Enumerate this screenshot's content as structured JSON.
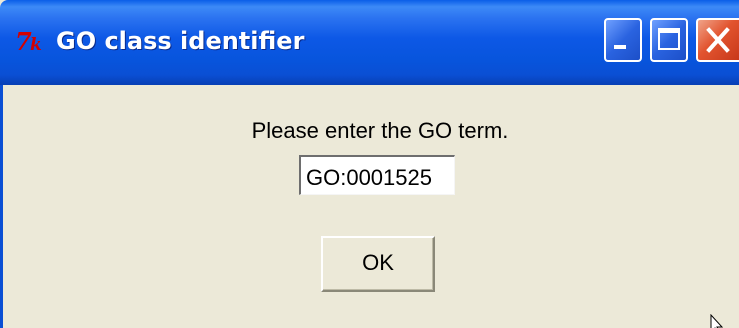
{
  "window": {
    "title": "GO class identifier",
    "title_icon": "tk-feather-icon",
    "controls": {
      "minimize_icon": "minimize-icon",
      "maximize_icon": "maximize-icon",
      "close_icon": "close-icon"
    },
    "colors": {
      "titlebar": "#0a55dd",
      "client_background": "#ece9d8",
      "close_button": "#e2542f",
      "tk_logo": "#d40000"
    }
  },
  "dialog": {
    "prompt": "Please enter the GO term.",
    "go_term_value": "GO:0001525",
    "ok_label": "OK"
  },
  "cursor_icon": "mouse-pointer-icon"
}
